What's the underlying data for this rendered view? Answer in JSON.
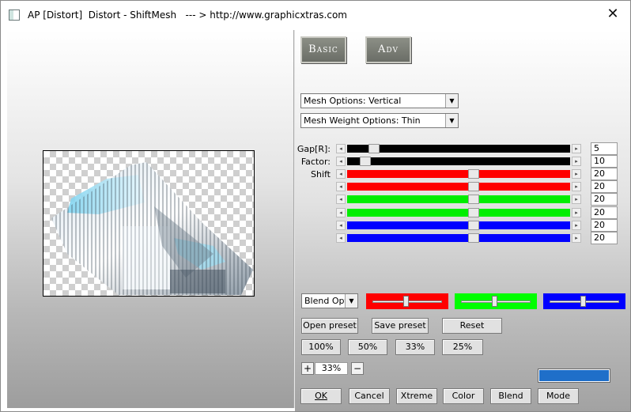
{
  "window": {
    "title": "AP [Distort]  Distort - ShiftMesh   --- > http://www.graphicxtras.com",
    "close_glyph": "✕"
  },
  "tabs": {
    "basic": "Basic",
    "adv": "Adv"
  },
  "mesh_options": {
    "selected": "Mesh Options: Vertical"
  },
  "mesh_weight_options": {
    "selected": "Mesh Weight Options: Thin"
  },
  "sliders": [
    {
      "label": "Gap[R]:",
      "value": "5",
      "level": 0.1,
      "color": "#000000"
    },
    {
      "label": "Factor:",
      "value": "10",
      "level": 0.06,
      "color": "#000000"
    },
    {
      "label": "Shift",
      "value": "20",
      "level": 0.57,
      "color": "#ff0000"
    },
    {
      "label": "",
      "value": "20",
      "level": 0.57,
      "color": "#ff0000"
    },
    {
      "label": "",
      "value": "20",
      "level": 0.57,
      "color": "#00ee00"
    },
    {
      "label": "",
      "value": "20",
      "level": 0.57,
      "color": "#00ee00"
    },
    {
      "label": "",
      "value": "20",
      "level": 0.57,
      "color": "#0000ff"
    },
    {
      "label": "",
      "value": "20",
      "level": 0.57,
      "color": "#0000ff"
    }
  ],
  "blend": {
    "selected": "Blend Options",
    "sliders": [
      {
        "color": "#ff0000",
        "level": 0.48
      },
      {
        "color": "#00ff00",
        "level": 0.48
      },
      {
        "color": "#0000ff",
        "level": 0.48
      }
    ]
  },
  "buttons": {
    "open_preset": "Open preset",
    "save_preset": "Save preset",
    "reset": "Reset",
    "zoom_100": "100%",
    "zoom_50": "50%",
    "zoom_33": "33%",
    "zoom_25": "25%",
    "zoom_plus": "+",
    "zoom_minus": "−",
    "ok": "OK",
    "cancel": "Cancel",
    "xtreme": "Xtreme",
    "color": "Color",
    "blend": "Blend",
    "mode": "Mode"
  },
  "zoom": {
    "value": "33%"
  },
  "color_swatch": {
    "color": "#1f6fc9"
  }
}
